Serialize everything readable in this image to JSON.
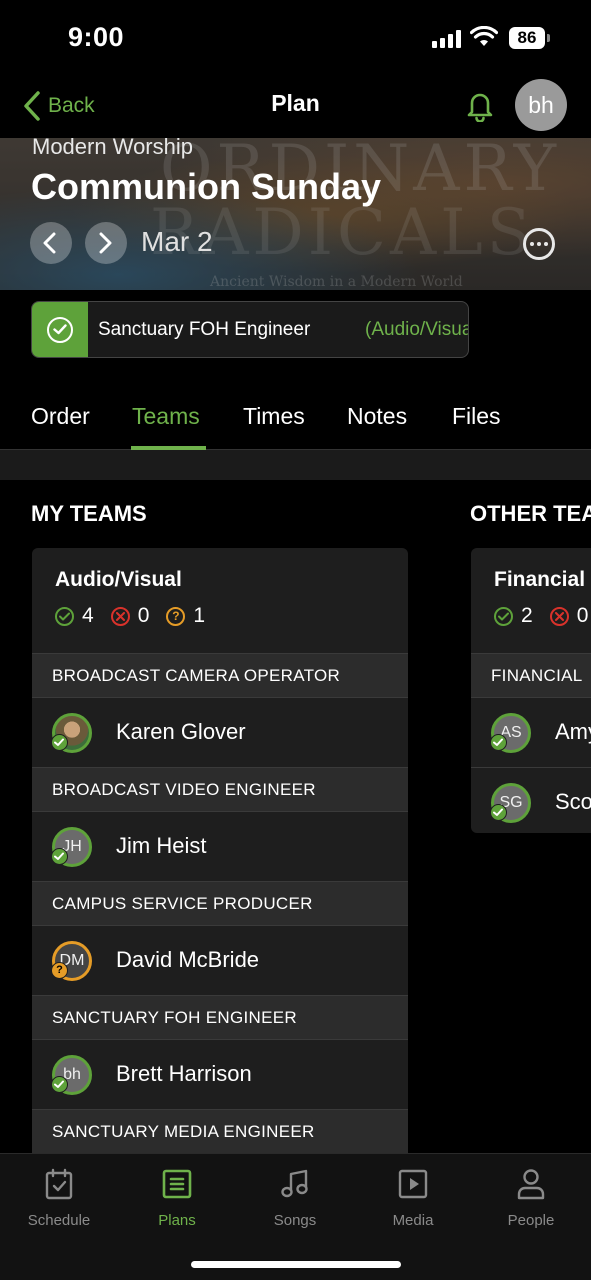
{
  "status_bar": {
    "time": "9:00",
    "battery": "86"
  },
  "nav": {
    "back_label": "Back",
    "title": "Plan",
    "avatar_initials": "bh"
  },
  "hero": {
    "service_type": "Modern Worship",
    "title": "Communion Sunday",
    "date": "Mar 2",
    "background_text": [
      "ORDINARY",
      "RADICALS",
      "Ancient Wisdom in a Modern World"
    ]
  },
  "position": {
    "name": "Sanctuary FOH Engineer",
    "team": "(Audio/Visual)"
  },
  "tabs": [
    {
      "label": "Order"
    },
    {
      "label": "Teams",
      "active": true
    },
    {
      "label": "Times"
    },
    {
      "label": "Notes"
    },
    {
      "label": "Files"
    }
  ],
  "my_teams": {
    "heading": "MY TEAMS",
    "team": {
      "name": "Audio/Visual",
      "confirmed": "4",
      "declined": "0",
      "pending": "1",
      "roles": [
        {
          "title": "BROADCAST CAMERA OPERATOR",
          "people": [
            {
              "name": "Karen Glover",
              "initials": "",
              "status": "confirmed",
              "photo": true
            }
          ]
        },
        {
          "title": "BROADCAST VIDEO ENGINEER",
          "people": [
            {
              "name": "Jim Heist",
              "initials": "JH",
              "status": "confirmed"
            }
          ]
        },
        {
          "title": "CAMPUS SERVICE PRODUCER",
          "people": [
            {
              "name": "David McBride",
              "initials": "DM",
              "status": "pending"
            }
          ]
        },
        {
          "title": "SANCTUARY FOH ENGINEER",
          "people": [
            {
              "name": "Brett Harrison",
              "initials": "bh",
              "status": "confirmed"
            }
          ]
        },
        {
          "title": "SANCTUARY MEDIA ENGINEER",
          "people": []
        }
      ]
    }
  },
  "other_teams": {
    "heading": "OTHER TEA",
    "team": {
      "name": "Financial",
      "confirmed": "2",
      "declined": "0",
      "roles": [
        {
          "title": "FINANCIAL",
          "people": [
            {
              "name": "Amy",
              "initials": "AS"
            },
            {
              "name": "Sco",
              "initials": "SG"
            }
          ]
        }
      ]
    }
  },
  "tab_bar": {
    "items": [
      {
        "label": "Schedule",
        "icon": "calendar-check-icon"
      },
      {
        "label": "Plans",
        "icon": "list-icon",
        "active": true
      },
      {
        "label": "Songs",
        "icon": "music-note-icon"
      },
      {
        "label": "Media",
        "icon": "play-square-icon"
      },
      {
        "label": "People",
        "icon": "person-icon"
      }
    ]
  },
  "colors": {
    "accent": "#6fb24b",
    "confirmed": "#5ea23a",
    "declined": "#d9322b",
    "pending": "#e59c27",
    "background": "#000000",
    "card": "#1e1e1e"
  }
}
